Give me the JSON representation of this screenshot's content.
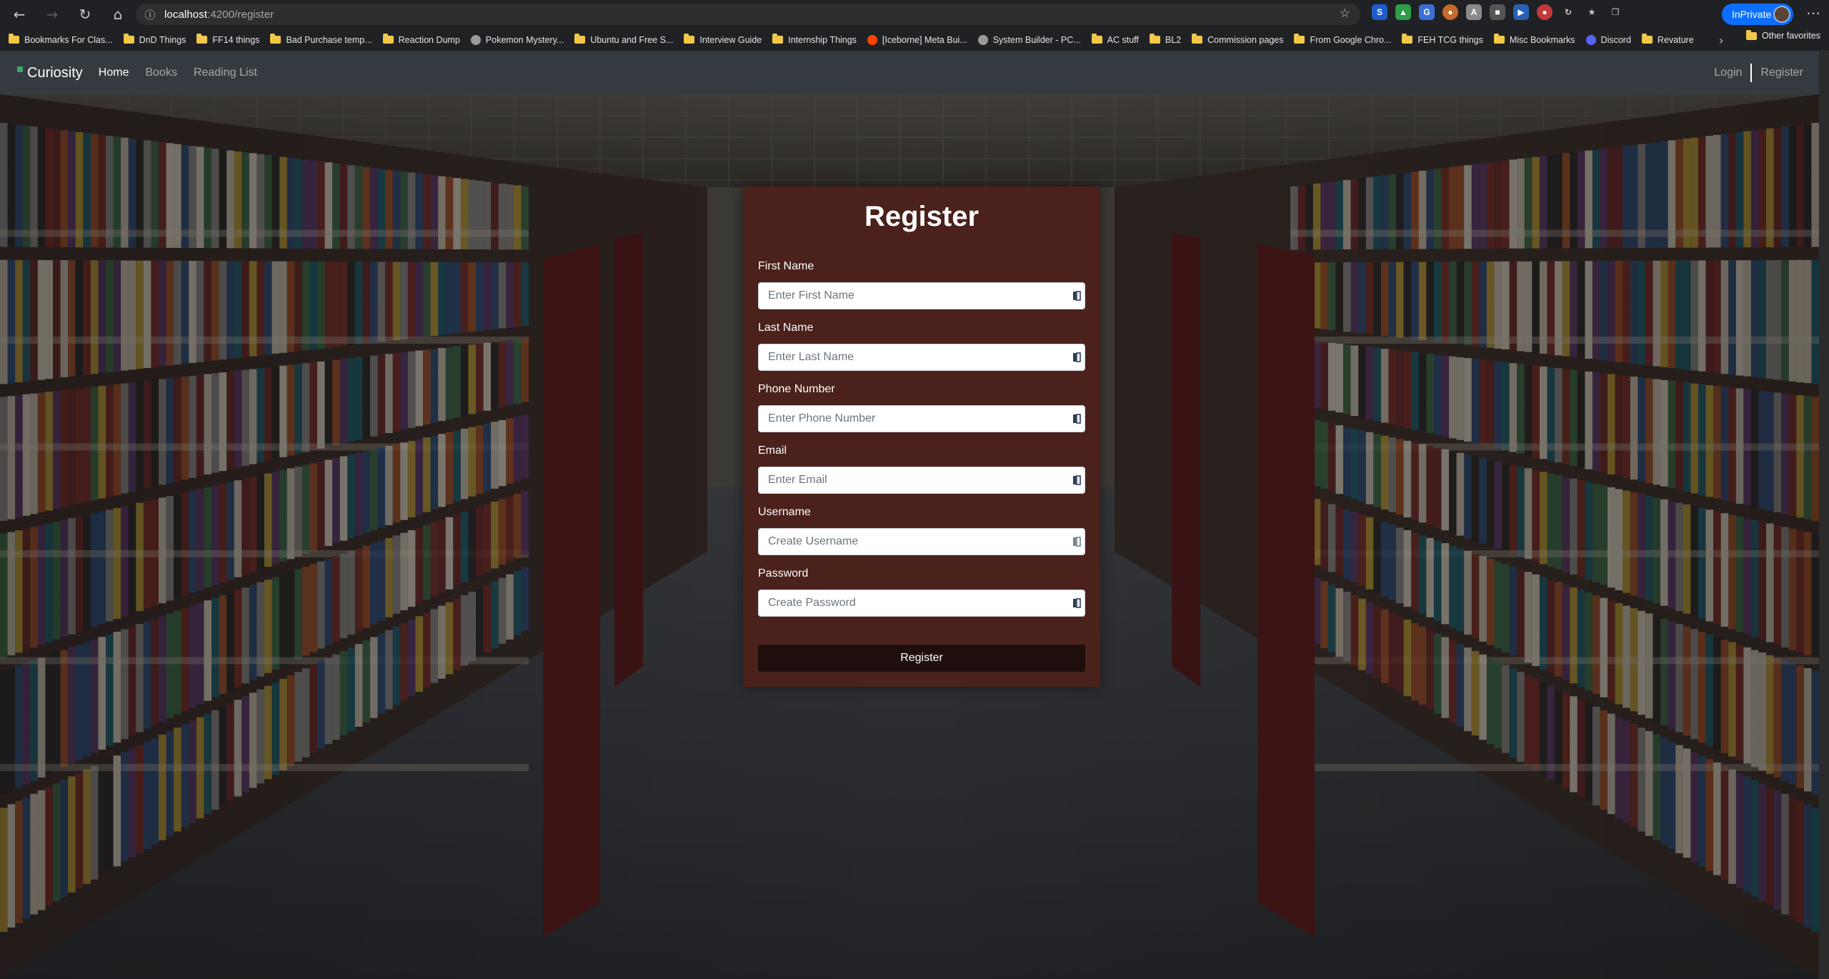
{
  "browser": {
    "url_host": "localhost",
    "url_path": ":4200/register",
    "inprivate_label": "InPrivate",
    "bookmarks": [
      {
        "label": "Bookmarks For Clas...",
        "icon": "folder-icon"
      },
      {
        "label": "DnD Things",
        "icon": "folder-icon"
      },
      {
        "label": "FF14 things",
        "icon": "folder-icon"
      },
      {
        "label": "Bad Purchase temp...",
        "icon": "folder-icon"
      },
      {
        "label": "Reaction Dump",
        "icon": "folder-icon"
      },
      {
        "label": "Pokemon Mystery...",
        "icon": "site-icon"
      },
      {
        "label": "Ubuntu and Free S...",
        "icon": "folder-icon"
      },
      {
        "label": "Interview Guide",
        "icon": "folder-icon"
      },
      {
        "label": "Internship Things",
        "icon": "folder-icon"
      },
      {
        "label": "[Iceborne] Meta Bui...",
        "icon": "reddit-icon"
      },
      {
        "label": "System Builder - PC...",
        "icon": "site-icon"
      },
      {
        "label": "AC stuff",
        "icon": "folder-icon"
      },
      {
        "label": "BL2",
        "icon": "folder-icon"
      },
      {
        "label": "Commission pages",
        "icon": "folder-icon"
      },
      {
        "label": "From Google Chro...",
        "icon": "folder-icon"
      },
      {
        "label": "FEH TCG things",
        "icon": "folder-icon"
      },
      {
        "label": "Misc Bookmarks",
        "icon": "folder-icon"
      },
      {
        "label": "Discord",
        "icon": "discord-icon"
      },
      {
        "label": "Revature",
        "icon": "folder-icon"
      }
    ],
    "other_favorites": "Other favorites"
  },
  "navbar": {
    "brand": "Curiosity",
    "links": [
      "Home",
      "Books",
      "Reading List"
    ],
    "active": "Home",
    "right_links": [
      "Login",
      "Register"
    ]
  },
  "form": {
    "title": "Register",
    "fields": [
      {
        "label": "First Name",
        "placeholder": "Enter First Name",
        "value": ""
      },
      {
        "label": "Last Name",
        "placeholder": "Enter Last Name",
        "value": ""
      },
      {
        "label": "Phone Number",
        "placeholder": "Enter Phone Number",
        "value": ""
      },
      {
        "label": "Email",
        "placeholder": "Enter Email",
        "value": ""
      },
      {
        "label": "Username",
        "placeholder": "Create Username",
        "value": ""
      },
      {
        "label": "Password",
        "placeholder": "Create Password",
        "value": ""
      }
    ],
    "submit_label": "Register"
  },
  "colors": {
    "navbar_bg": "#343a40",
    "card_bg": "#4a211b",
    "submit_bg": "#1e0f0d",
    "inprivate_accent": "#0d6efd"
  }
}
